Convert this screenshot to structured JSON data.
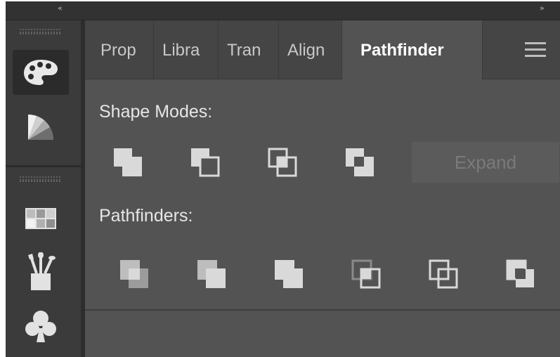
{
  "window": {
    "collapse_left_glyph": "«",
    "collapse_right_glyph": "»"
  },
  "sidebar": {
    "tools": [
      {
        "name": "color-palette-icon",
        "active": true
      },
      {
        "name": "color-guide-icon",
        "active": false
      },
      {
        "name": "swatches-grid-icon",
        "active": false
      },
      {
        "name": "brushes-icon",
        "active": false
      },
      {
        "name": "symbols-club-icon",
        "active": false
      }
    ]
  },
  "panel": {
    "tabs": [
      {
        "label": "Prop",
        "active": false
      },
      {
        "label": "Libra",
        "active": false
      },
      {
        "label": "Tran",
        "active": false
      },
      {
        "label": "Align",
        "active": false
      },
      {
        "label": "Pathfinder",
        "active": true
      }
    ],
    "shape_modes_title": "Shape Modes:",
    "shape_modes": [
      "unite-icon",
      "minus-front-icon",
      "intersect-icon",
      "exclude-icon"
    ],
    "expand_label": "Expand",
    "pathfinders_title": "Pathfinders:",
    "pathfinders": [
      "divide-icon",
      "trim-icon",
      "merge-icon",
      "crop-icon",
      "outline-icon",
      "minus-back-icon"
    ]
  },
  "colors": {
    "panel_bg": "#535353",
    "tab_bg": "#454545",
    "sidebar_bg": "#3b3b3b",
    "icon_fill": "#d9d9d9",
    "text": "#e6e6e6"
  }
}
